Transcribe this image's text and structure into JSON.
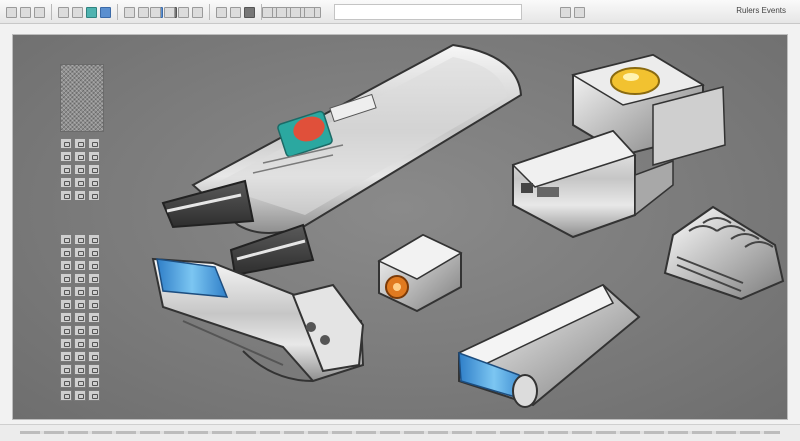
{
  "toolbar": {
    "right_label": "Rulers Events",
    "accent_colors": {
      "blue": "#5a8fd0",
      "teal": "#4fb3b0"
    }
  },
  "canvas": {
    "background": "#7b7b7b",
    "objects": [
      "usb-flash-drive",
      "camera-module",
      "microchip-component",
      "clip-connector",
      "small-connector-block",
      "battery-module"
    ],
    "accent_colors": {
      "lens_yellow": "#f2c230",
      "label_red": "#e0503a",
      "label_blue": "#3ca0e0",
      "connector_orange": "#e07a20"
    }
  },
  "palette": {
    "icons": [
      "pattern-swatch",
      "tool-grid-top",
      "tool-grid-bottom"
    ]
  }
}
